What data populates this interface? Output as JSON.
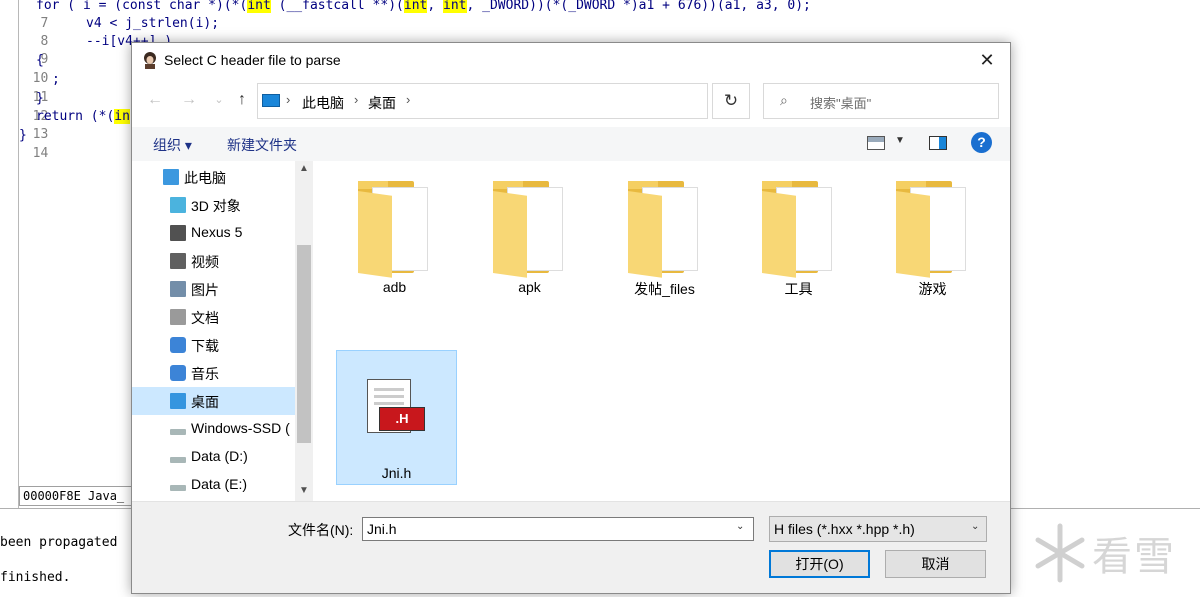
{
  "code": {
    "lines": [
      {
        "n": "7",
        "text_parts": [
          "for ( i = (const char *)(*(",
          "int",
          " (__fastcall **)(",
          "int",
          ", ",
          "int",
          ", _DWORD))(*(_DWORD *)a1 + 676))(a1, a3, 0);"
        ]
      },
      {
        "n": "8",
        "text": "v4 < j_strlen(i);"
      },
      {
        "n": "9",
        "text": "--i[v4++] )"
      },
      {
        "n": "10",
        "text": "{"
      },
      {
        "n": "11",
        "text": ";"
      },
      {
        "n": "12",
        "text": "}"
      },
      {
        "n": "13",
        "text_parts": [
          "return (*(",
          "in"
        ]
      },
      {
        "n": "14",
        "text": "}"
      }
    ],
    "status_strip": "00000F8E Java_",
    "output_lines": [
      "been propagated",
      "finished."
    ]
  },
  "watermark": {
    "text": "看雪"
  },
  "dialog": {
    "title": "Select C header file to parse",
    "close_glyph": "✕",
    "nav": {
      "back": "←",
      "forward": "→",
      "recent": "⌄",
      "up": "↑",
      "refresh": "↻"
    },
    "breadcrumb": [
      "此电脑",
      "桌面"
    ],
    "search_placeholder": "搜索\"桌面\"",
    "toolbar": {
      "organize": "组织 ▾",
      "new_folder": "新建文件夹",
      "help": "?"
    },
    "tree": [
      {
        "label": "此电脑",
        "icon": "pc-icon",
        "indent": 0
      },
      {
        "label": "3D 对象",
        "icon": "3d-objects-icon",
        "indent": 1
      },
      {
        "label": "Nexus 5",
        "icon": "phone-icon",
        "indent": 1
      },
      {
        "label": "视频",
        "icon": "video-icon",
        "indent": 1
      },
      {
        "label": "图片",
        "icon": "pictures-icon",
        "indent": 1
      },
      {
        "label": "文档",
        "icon": "documents-icon",
        "indent": 1
      },
      {
        "label": "下载",
        "icon": "download-icon",
        "indent": 1
      },
      {
        "label": "音乐",
        "icon": "music-icon",
        "indent": 1
      },
      {
        "label": "桌面",
        "icon": "desktop-icon",
        "indent": 1,
        "selected": true
      },
      {
        "label": "Windows-SSD (",
        "icon": "drive-icon",
        "indent": 1
      },
      {
        "label": "Data (D:)",
        "icon": "drive-icon",
        "indent": 1
      },
      {
        "label": "Data (E:)",
        "icon": "drive-icon",
        "indent": 1
      }
    ],
    "files": [
      {
        "name": "adb",
        "type": "folder"
      },
      {
        "name": "apk",
        "type": "folder"
      },
      {
        "name": "发帖_files",
        "type": "folder"
      },
      {
        "name": "工具",
        "type": "folder"
      },
      {
        "name": "游戏",
        "type": "folder"
      },
      {
        "name": "Jni.h",
        "type": "h-file",
        "selected": true,
        "badge": ".H"
      }
    ],
    "filename_label": "文件名(N):",
    "filename_value": "Jni.h",
    "filter_value": "H files (*.hxx *.hpp *.h)",
    "open_button": "打开(O)",
    "cancel_button": "取消"
  }
}
